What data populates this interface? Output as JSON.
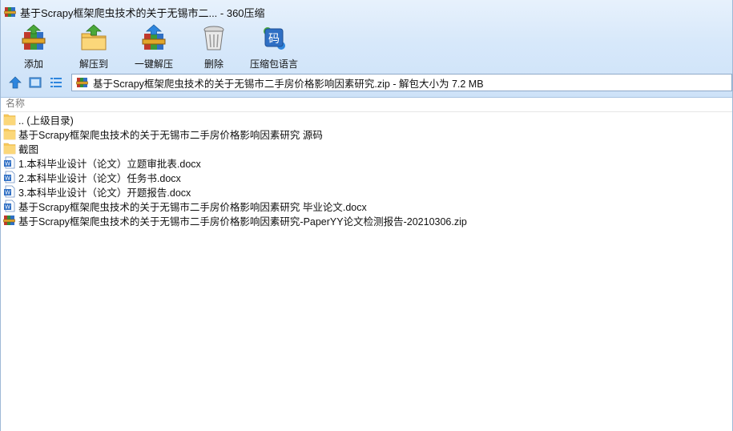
{
  "window": {
    "title": "基于Scrapy框架爬虫技术的关于无锡市二... - 360压缩"
  },
  "toolbar": {
    "buttons": [
      {
        "id": "add",
        "label": "添加",
        "icon": "add-books-icon"
      },
      {
        "id": "extract",
        "label": "解压到",
        "icon": "folder-up-arrow-icon"
      },
      {
        "id": "oneclick",
        "label": "一键解压",
        "icon": "books-up-arrow-icon"
      },
      {
        "id": "delete",
        "label": "删除",
        "icon": "trash-can-icon"
      },
      {
        "id": "lang",
        "label": "压缩包语言",
        "icon": "code-page-icon",
        "glyph": "码"
      }
    ]
  },
  "address": {
    "text": "基于Scrapy框架爬虫技术的关于无锡市二手房价格影响因素研究.zip - 解包大小为 7.2 MB"
  },
  "list": {
    "header_name": "名称",
    "items": [
      {
        "name": ".. (上级目录)",
        "type": "folder"
      },
      {
        "name": "基于Scrapy框架爬虫技术的关于无锡市二手房价格影响因素研究 源码",
        "type": "folder"
      },
      {
        "name": "截图",
        "type": "folder"
      },
      {
        "name": "1.本科毕业设计（论文）立题审批表.docx",
        "type": "docx"
      },
      {
        "name": "2.本科毕业设计（论文）任务书.docx",
        "type": "docx"
      },
      {
        "name": "3.本科毕业设计（论文）开题报告.docx",
        "type": "docx"
      },
      {
        "name": "基于Scrapy框架爬虫技术的关于无锡市二手房价格影响因素研究 毕业论文.docx",
        "type": "docx"
      },
      {
        "name": "基于Scrapy框架爬虫技术的关于无锡市二手房价格影响因素研究-PaperYY论文检测报告-20210306.zip",
        "type": "zip"
      }
    ]
  },
  "colors": {
    "band_top": "#e7f1fc",
    "band_bottom": "#cde2f8",
    "folder": "#f7c95a",
    "doc_blue": "#2f6fc4",
    "nav_blue": "#2e86de"
  }
}
